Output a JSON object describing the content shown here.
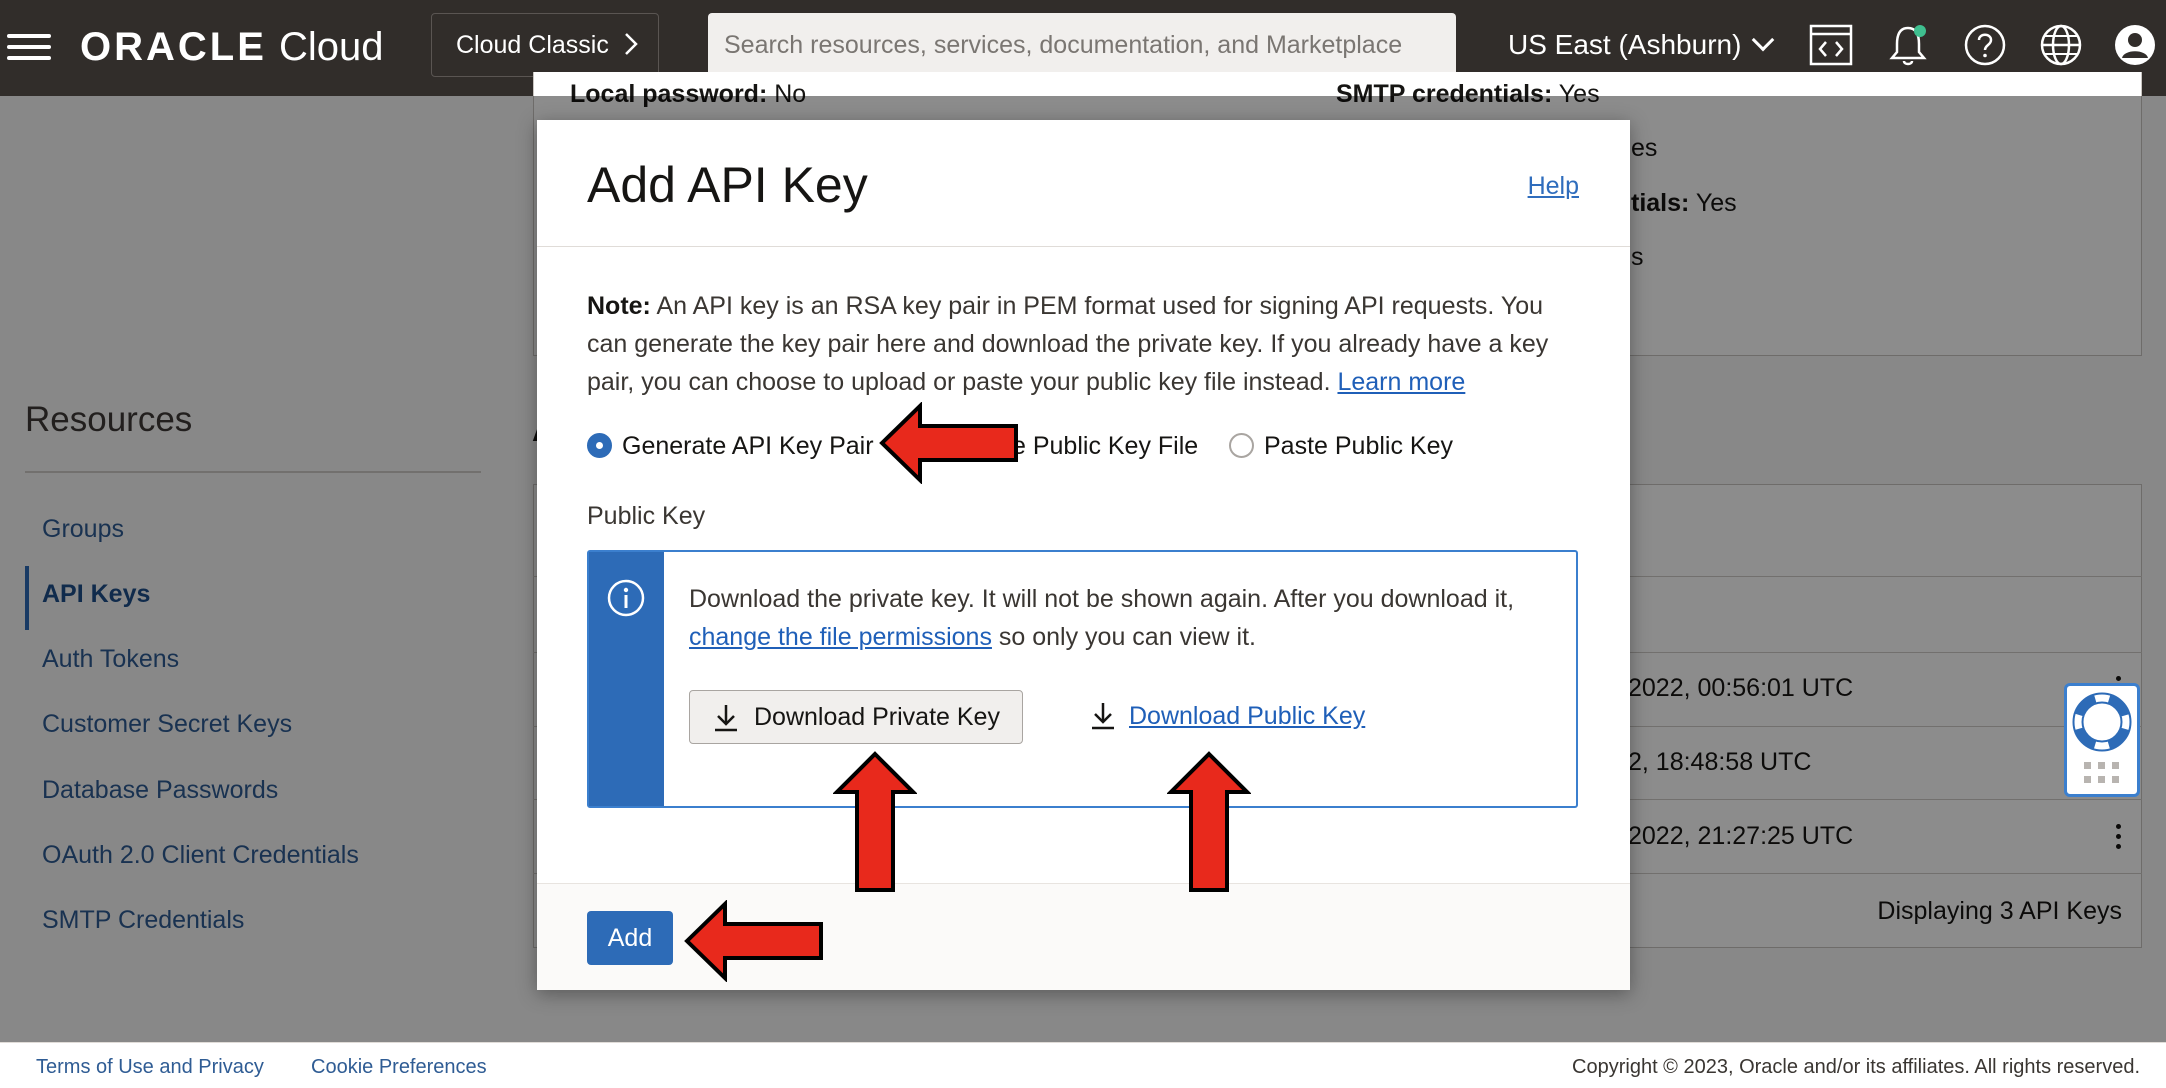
{
  "header": {
    "brand": "ORACLE",
    "product": "Cloud",
    "classic_label": "Cloud Classic",
    "search_placeholder": "Search resources, services, documentation, and Marketplace",
    "region": "US East (Ashburn)",
    "icons": [
      "code-editor-icon",
      "notifications-icon",
      "help-icon",
      "language-icon",
      "profile-icon"
    ],
    "notification_dot_color": "#3fbf8f"
  },
  "background_details": {
    "local_password_label": "Local password:",
    "local_password_value": "No",
    "smtp_label": "SMTP credentials:",
    "smtp_value": "Yes",
    "row2_value": "es",
    "row3_label": "tials:",
    "row3_value": "Yes",
    "row4_value": "s"
  },
  "resources": {
    "title": "Resources",
    "items": [
      {
        "label": "Groups",
        "active": false
      },
      {
        "label": "API Keys",
        "active": true
      },
      {
        "label": "Auth Tokens",
        "active": false
      },
      {
        "label": "Customer Secret Keys",
        "active": false
      },
      {
        "label": "Database Passwords",
        "active": false
      },
      {
        "label": "OAuth 2.0 Client Credentials",
        "active": false
      },
      {
        "label": "SMTP Credentials",
        "active": false
      }
    ]
  },
  "api_keys_table": {
    "heading_fragment": "A",
    "rows": [
      "2022, 00:56:01 UTC",
      "2, 18:48:58 UTC",
      "2022, 21:27:25 UTC"
    ],
    "footer": "Displaying 3 API Keys"
  },
  "modal": {
    "title": "Add API Key",
    "help": "Help",
    "note_label": "Note:",
    "note_text": " An API key is an RSA key pair in PEM format used for signing API requests. You can generate the key pair here and download the private key. If you already have a key pair, you can choose to upload or paste your public key file instead. ",
    "learn_more": "Learn more",
    "options": [
      {
        "label": "Generate API Key Pair",
        "selected": true
      },
      {
        "label": "e Public Key File",
        "selected": false
      },
      {
        "label": "Paste Public Key",
        "selected": false
      }
    ],
    "public_key_label": "Public Key",
    "info_text_1": "Download the private key. It will not be shown again. After you download it, ",
    "info_link": "change the file permissions",
    "info_text_2": " so only you can view it.",
    "download_private": "Download Private Key",
    "download_public": "Download Public Key",
    "add_button": "Add"
  },
  "footer": {
    "terms": "Terms of Use and Privacy",
    "cookies": "Cookie Preferences",
    "copyright": "Copyright © 2023, Oracle and/or its affiliates. All rights reserved."
  },
  "colors": {
    "header_bg": "#312d2a",
    "accent": "#2d6bb7",
    "annotation_arrow": "#e8291c"
  }
}
